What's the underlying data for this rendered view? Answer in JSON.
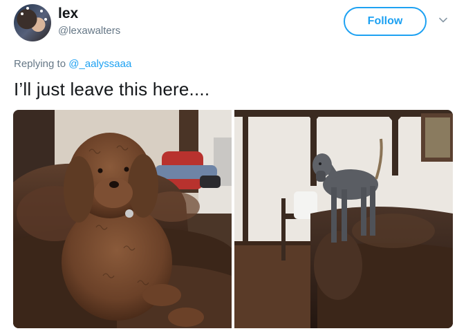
{
  "author": {
    "display_name": "lex",
    "username": "@lexawalters",
    "avatar_icon": "profile-photo"
  },
  "follow_button": {
    "label": "Follow"
  },
  "menu_icon": "chevron-down-icon",
  "reply": {
    "prefix": "Replying to ",
    "mention": "@_aalyssaaa"
  },
  "tweet": {
    "text": "I’ll just leave this here...."
  },
  "media": {
    "photos": [
      {
        "description_icon": "dog-on-couch-photo"
      },
      {
        "description_icon": "great-dane-on-couch-photo"
      }
    ]
  },
  "colors": {
    "accent": "#1da1f2",
    "secondary_text": "#657786",
    "primary_text": "#14171a"
  }
}
